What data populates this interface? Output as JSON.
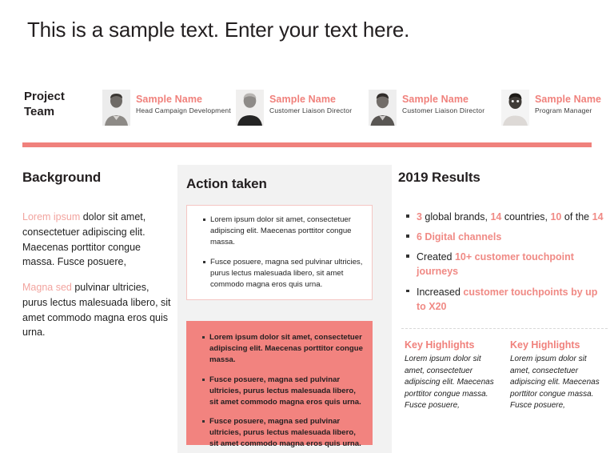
{
  "slide": {
    "headline": "This is a sample text. Enter your text here.",
    "accent_color": "#f0817c",
    "panel_bg": "#f2f2f2",
    "pink_box": "#f2837f"
  },
  "team": {
    "label": "Project\nTeam",
    "label_line1": "Project",
    "label_line2": "Team",
    "members": [
      {
        "name": "Sample Name",
        "role": "Head Campaign Development",
        "photo": "portrait-photo"
      },
      {
        "name": "Sample Name",
        "role": "Customer Liaison Director",
        "photo": "portrait-photo"
      },
      {
        "name": "Sample Name",
        "role": "Customer Liaison  Director",
        "photo": "portrait-photo"
      },
      {
        "name": "Sample Name",
        "role": "Program Manager",
        "photo": "portrait-photo"
      }
    ]
  },
  "background": {
    "title": "Background",
    "para1_accent": "Lorem ipsum",
    "para1_rest": " dolor sit amet, consectetuer adipiscing elit. Maecenas porttitor congue massa. Fusce posuere,",
    "para2_accent": "Magna sed",
    "para2_rest": " pulvinar ultricies, purus lectus malesuada libero, sit amet commodo magna eros quis urna."
  },
  "action": {
    "title": "Action taken",
    "white_bullets": [
      "Lorem ipsum dolor sit amet, consectetuer adipiscing elit. Maecenas porttitor congue massa.",
      "Fusce posuere, magna sed pulvinar ultricies, purus lectus malesuada libero, sit amet commodo magna eros quis urna."
    ],
    "pink_bullets": [
      "Lorem ipsum dolor sit amet, consectetuer adipiscing elit. Maecenas porttitor congue massa.",
      "Fusce posuere, magna sed pulvinar ultricies, purus lectus malesuada libero, sit amet commodo magna eros quis urna.",
      "Fusce posuere, magna sed pulvinar ultricies, purus lectus malesuada libero, sit amet commodo magna eros quis urna."
    ]
  },
  "results": {
    "title": "2019 Results",
    "bullets": [
      {
        "parts": [
          {
            "t": "3",
            "s": "hl"
          },
          {
            "t": " global brands, ",
            "s": "plain"
          },
          {
            "t": "14",
            "s": "hl"
          },
          {
            "t": " countries, ",
            "s": "plain"
          },
          {
            "t": "10",
            "s": "hl"
          },
          {
            "t": " of the ",
            "s": "plain"
          },
          {
            "t": "14",
            "s": "hl"
          }
        ]
      },
      {
        "parts": [
          {
            "t": "6 Digital channels",
            "s": "hl"
          }
        ]
      },
      {
        "parts": [
          {
            "t": "Created ",
            "s": "plain"
          },
          {
            "t": "10+ customer touchpoint journeys",
            "s": "hl"
          }
        ]
      },
      {
        "parts": [
          {
            "t": "Increased ",
            "s": "plain"
          },
          {
            "t": "customer touchpoints by up to X20",
            "s": "hl"
          }
        ]
      }
    ],
    "highlights": [
      {
        "title": "Key Highlights",
        "body": "Lorem ipsum dolor sit amet, consectetuer adipiscing elit. Maecenas porttitor congue massa. Fusce posuere,"
      },
      {
        "title": "Key Highlights",
        "body": "Lorem ipsum dolor sit amet, consectetuer adipiscing elit. Maecenas porttitor congue massa. Fusce posuere,"
      }
    ]
  }
}
